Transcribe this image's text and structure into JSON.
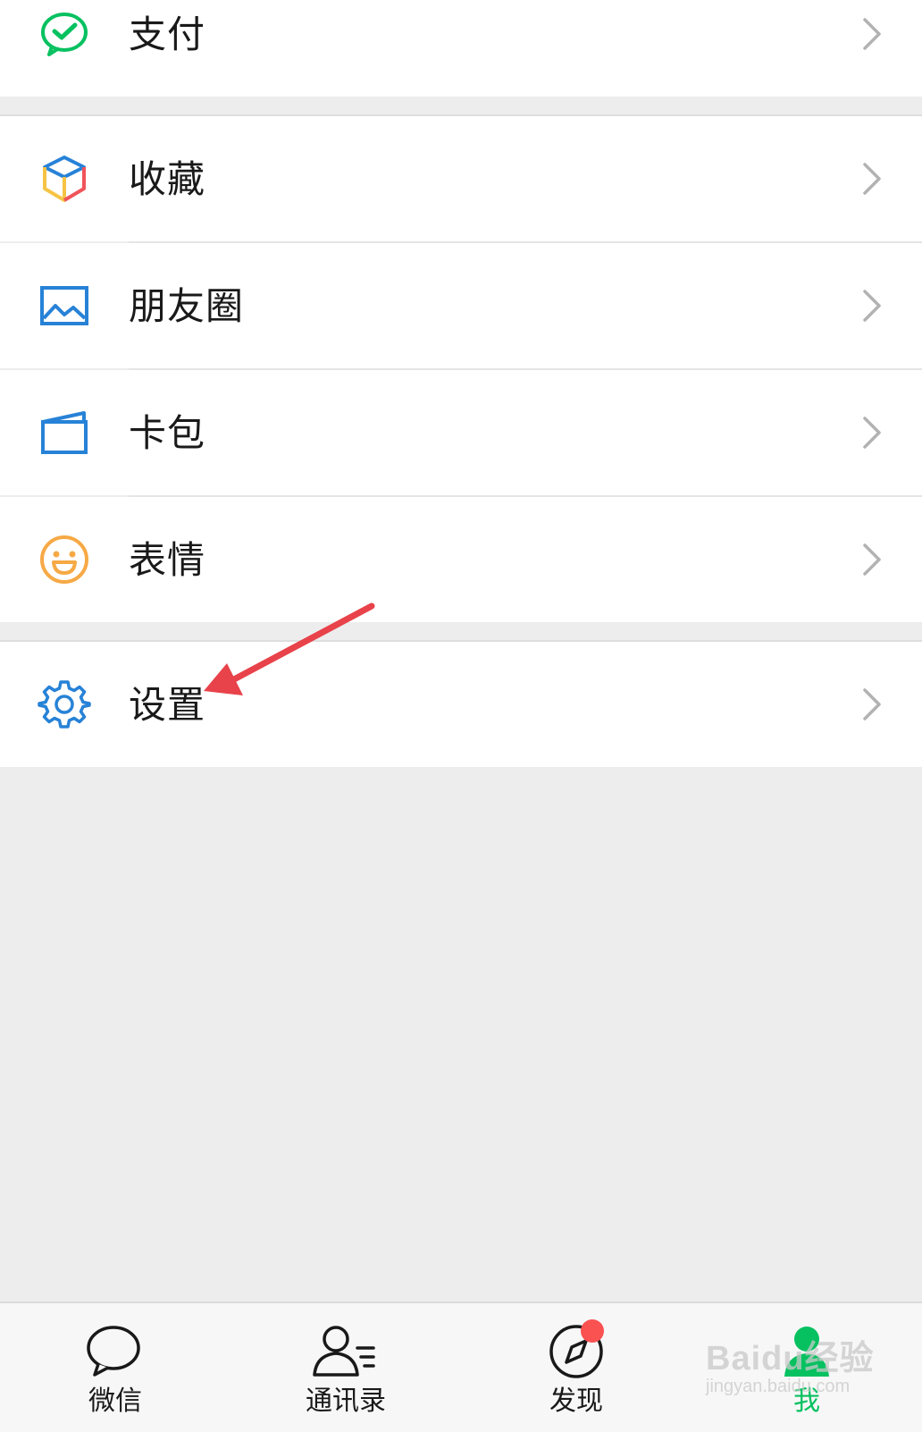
{
  "menu": {
    "pay": "支付",
    "favorites": "收藏",
    "moments": "朋友圈",
    "card_pack": "卡包",
    "stickers": "表情",
    "settings": "设置"
  },
  "tabs": {
    "chats": "微信",
    "contacts": "通讯录",
    "discover": "发现",
    "me": "我"
  },
  "colors": {
    "green": "#07c160",
    "blue": "#2782d7",
    "orange": "#f6a945",
    "badge": "#fa5151",
    "annotation_arrow": "#e8424a"
  },
  "watermark": {
    "brand": "Baidu经验",
    "url": "jingyan.baidu.com"
  }
}
